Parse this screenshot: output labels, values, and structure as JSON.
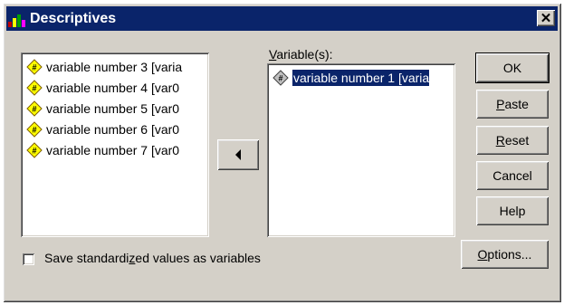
{
  "window": {
    "title": "Descriptives",
    "close_glyph": "✕"
  },
  "source_list": {
    "items": [
      {
        "label": "variable number 3 [varia",
        "icon": "scale-variable-icon"
      },
      {
        "label": "variable number 4 [var0",
        "icon": "scale-variable-icon"
      },
      {
        "label": "variable number 5 [var0",
        "icon": "scale-variable-icon"
      },
      {
        "label": "variable number 6 [var0",
        "icon": "scale-variable-icon"
      },
      {
        "label": "variable number 7 [var0",
        "icon": "scale-variable-icon"
      }
    ]
  },
  "transfer_button": {
    "arrow": "left-arrow-icon"
  },
  "variables": {
    "label_prefix": "V",
    "label_rest": "ariable(s):",
    "items": [
      {
        "label": "variable number 1 [varia",
        "icon": "scale-variable-icon",
        "selected": true
      }
    ]
  },
  "buttons": {
    "ok": "OK",
    "paste_mnemonic": "P",
    "paste_rest": "aste",
    "reset_mnemonic": "R",
    "reset_rest": "eset",
    "cancel": "Cancel",
    "help": "Help",
    "options_mnemonic": "O",
    "options_rest": "ptions..."
  },
  "save_standardized": {
    "label_a": "Save standardi",
    "label_mnemonic": "z",
    "label_b": "ed values as variables",
    "checked": false
  },
  "colors": {
    "titlebar": "#0a246a",
    "face": "#d4d0c8",
    "selection": "#0a246a",
    "icon_yellow": "#ffff00"
  }
}
